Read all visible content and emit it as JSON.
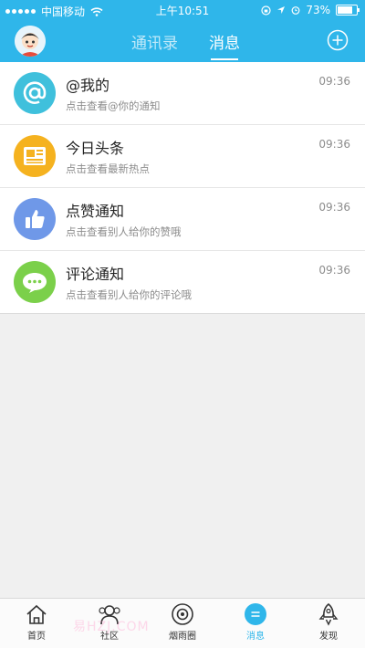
{
  "status_bar": {
    "carrier": "中国移动",
    "time": "上午10:51",
    "battery": "73%"
  },
  "nav": {
    "tabs": [
      {
        "label": "通讯录",
        "active": false
      },
      {
        "label": "消息",
        "active": true
      }
    ]
  },
  "messages": [
    {
      "title": "@我的",
      "subtitle": "点击查看@你的通知",
      "time": "09:36",
      "icon": "at-icon",
      "color": "#3fc0dc"
    },
    {
      "title": "今日头条",
      "subtitle": "点击查看最新热点",
      "time": "09:36",
      "icon": "newspaper-icon",
      "color": "#f5b21f"
    },
    {
      "title": "点赞通知",
      "subtitle": "点击查看别人给你的赞哦",
      "time": "09:36",
      "icon": "thumbs-up-icon",
      "color": "#6f98e8"
    },
    {
      "title": "评论通知",
      "subtitle": "点击查看别人给你的评论哦",
      "time": "09:36",
      "icon": "comment-icon",
      "color": "#7bd04a"
    }
  ],
  "tabbar": {
    "items": [
      {
        "label": "首页",
        "icon": "home-icon",
        "active": false
      },
      {
        "label": "社区",
        "icon": "community-icon",
        "active": false
      },
      {
        "label": "烟雨圈",
        "icon": "yanyu-circle-icon",
        "active": false
      },
      {
        "label": "消息",
        "icon": "message-icon",
        "active": true
      },
      {
        "label": "发现",
        "icon": "rocket-icon",
        "active": false
      }
    ]
  },
  "watermark": "易HZJ.COM",
  "colors": {
    "header": "#2fb6ea",
    "accent": "#2fb6ea"
  }
}
